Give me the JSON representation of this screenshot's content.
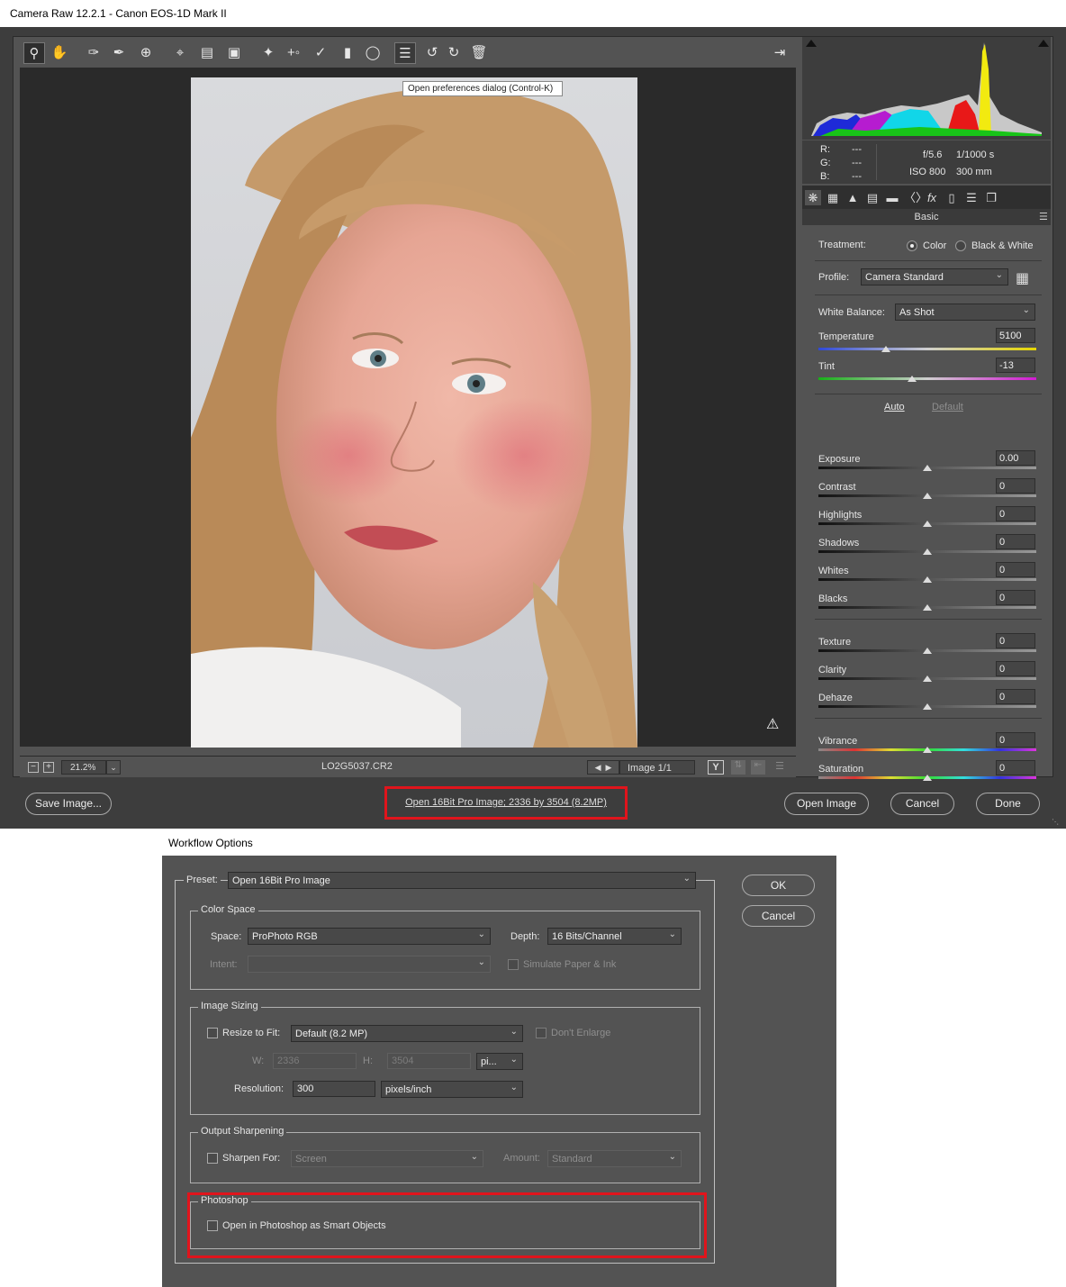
{
  "window": {
    "title": "Camera Raw 12.2.1  -  Canon EOS-1D Mark II"
  },
  "preview": {
    "tooltip": "Open preferences dialog (Control-K)",
    "zoom": "21.2%",
    "filename": "LO2G5037.CR2",
    "image_count": "Image 1/1"
  },
  "info": {
    "r_label": "R:",
    "g_label": "G:",
    "b_label": "B:",
    "r": "---",
    "g": "---",
    "b": "---",
    "aperture": "f/5.6",
    "shutter": "1/1000 s",
    "iso": "ISO 800",
    "focal": "300 mm"
  },
  "basic": {
    "panel_title": "Basic",
    "treatment_label": "Treatment:",
    "treatment_color": "Color",
    "treatment_bw": "Black & White",
    "profile_label": "Profile:",
    "profile_value": "Camera Standard",
    "wb_label": "White Balance:",
    "wb_value": "As Shot",
    "auto": "Auto",
    "default": "Default",
    "temperature": {
      "label": "Temperature",
      "value": "5100",
      "level": 0.31
    },
    "tint": {
      "label": "Tint",
      "value": "-13",
      "level": 0.43
    },
    "sliders": [
      {
        "label": "Exposure",
        "value": "0.00",
        "level": 0.5
      },
      {
        "label": "Contrast",
        "value": "0",
        "level": 0.5
      },
      {
        "label": "Highlights",
        "value": "0",
        "level": 0.5
      },
      {
        "label": "Shadows",
        "value": "0",
        "level": 0.5
      },
      {
        "label": "Whites",
        "value": "0",
        "level": 0.5
      },
      {
        "label": "Blacks",
        "value": "0",
        "level": 0.5
      },
      {
        "label": "Texture",
        "value": "0",
        "level": 0.5
      },
      {
        "label": "Clarity",
        "value": "0",
        "level": 0.5
      },
      {
        "label": "Dehaze",
        "value": "0",
        "level": 0.5
      },
      {
        "label": "Vibrance",
        "value": "0",
        "level": 0.5
      },
      {
        "label": "Saturation",
        "value": "0",
        "level": 0.5
      }
    ]
  },
  "footer": {
    "save": "Save Image...",
    "workflow_link": "Open 16Bit Pro Image; 2336 by 3504 (8.2MP)",
    "open": "Open Image",
    "cancel": "Cancel",
    "done": "Done"
  },
  "workflow": {
    "title": "Workflow Options",
    "preset_label": "Preset:",
    "preset_value": "Open 16Bit Pro Image",
    "ok": "OK",
    "cancel": "Cancel",
    "color_space": {
      "group": "Color Space",
      "space_label": "Space:",
      "space_value": "ProPhoto RGB",
      "depth_label": "Depth:",
      "depth_value": "16 Bits/Channel",
      "intent_label": "Intent:",
      "intent_value": "",
      "simulate": "Simulate Paper & Ink"
    },
    "image_sizing": {
      "group": "Image Sizing",
      "resize_label": "Resize to Fit:",
      "resize_value": "Default  (8.2 MP)",
      "dont_enlarge": "Don't Enlarge",
      "w_label": "W:",
      "w_value": "2336",
      "h_label": "H:",
      "h_value": "3504",
      "unit": "pi...",
      "resolution_label": "Resolution:",
      "resolution_value": "300",
      "resolution_unit": "pixels/inch"
    },
    "output_sharpening": {
      "group": "Output Sharpening",
      "sharpen_label": "Sharpen For:",
      "sharpen_value": "Screen",
      "amount_label": "Amount:",
      "amount_value": "Standard"
    },
    "photoshop": {
      "group": "Photoshop",
      "smart_objects": "Open in Photoshop as Smart Objects"
    }
  },
  "colors": {
    "highlight_red": "#e0141c",
    "panel_bg": "#535353"
  }
}
